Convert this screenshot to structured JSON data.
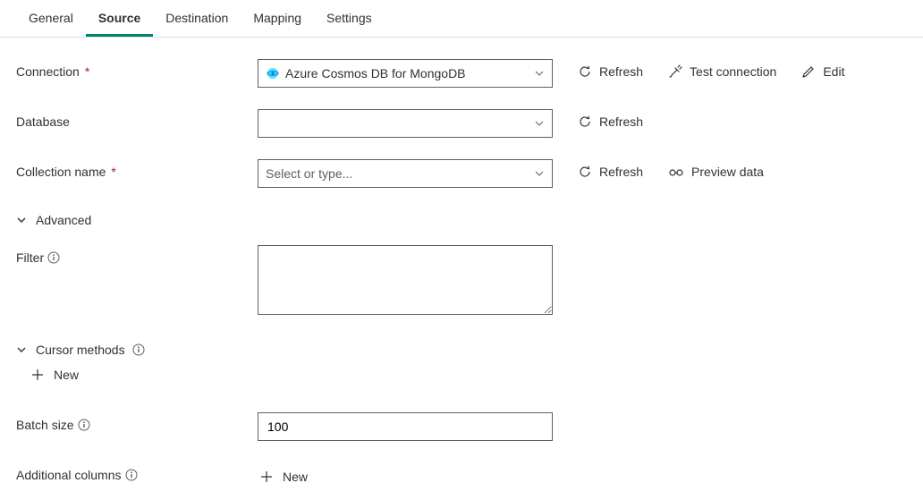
{
  "tabs": {
    "general": "General",
    "source": "Source",
    "destination": "Destination",
    "mapping": "Mapping",
    "settings": "Settings",
    "active": "source"
  },
  "labels": {
    "connection": "Connection",
    "database": "Database",
    "collection_name": "Collection name",
    "advanced": "Advanced",
    "filter": "Filter",
    "cursor_methods": "Cursor methods",
    "batch_size": "Batch size",
    "additional_columns": "Additional columns"
  },
  "fields": {
    "connection_value": "Azure Cosmos DB for MongoDB",
    "database_value": "",
    "collection_placeholder": "Select or type...",
    "filter_value": "",
    "batch_size_value": "100"
  },
  "actions": {
    "refresh": "Refresh",
    "test_connection": "Test connection",
    "edit": "Edit",
    "preview_data": "Preview data",
    "new": "New"
  }
}
